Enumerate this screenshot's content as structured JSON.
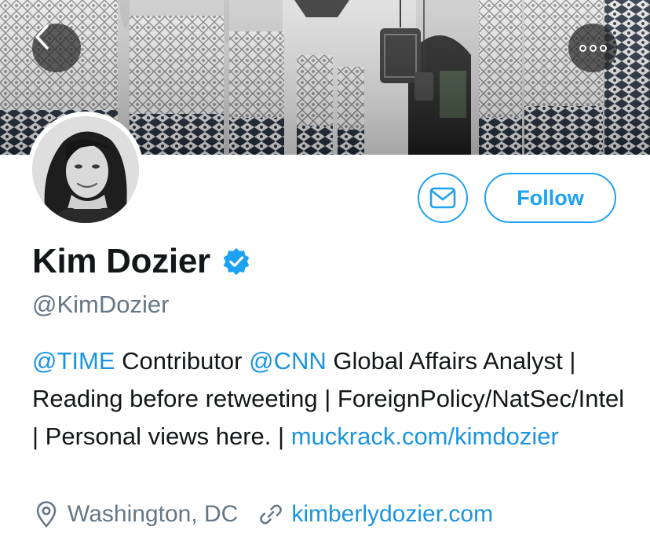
{
  "header": {
    "back_icon": "chevron-left-icon",
    "more_icon": "more-dots-icon"
  },
  "profile": {
    "display_name": "Kim Dozier",
    "verified_icon": "verified-badge-icon",
    "handle": "@KimDozier",
    "follow_label": "Follow",
    "message_icon": "envelope-icon"
  },
  "bio": {
    "mention_time": "@TIME",
    "text_1": " Contributor ",
    "mention_cnn": "@CNN",
    "text_2": " Global Affairs Analyst | Reading before retweeting | ForeignPolicy/NatSec/Intel | Personal views here. | ",
    "link": "muckrack.com/kimdozier"
  },
  "meta": {
    "location_icon": "location-pin-icon",
    "location": "Washington, DC",
    "website_icon": "link-icon",
    "website": "kimberlydozier.com"
  },
  "colors": {
    "accent": "#1da1f2",
    "link": "#1b95e0",
    "secondary_text": "#657786",
    "primary_text": "#14171a"
  }
}
